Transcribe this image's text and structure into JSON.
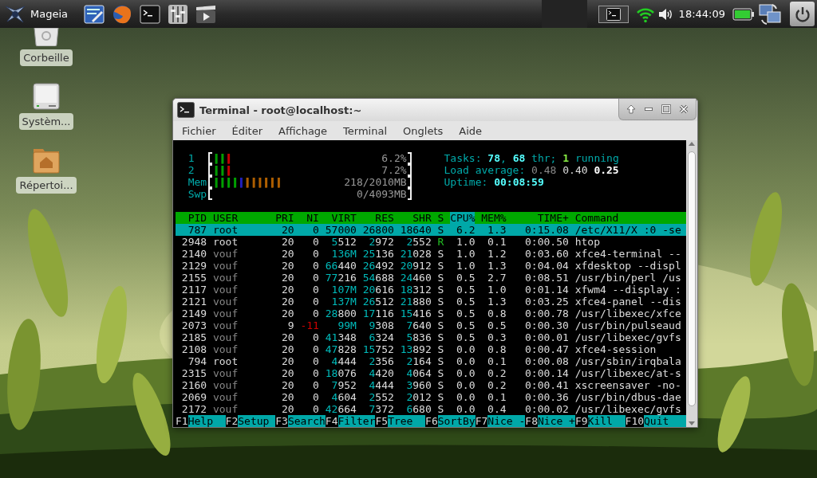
{
  "panel": {
    "app_menu": "Mageia",
    "clock": "18:44:09"
  },
  "desktop_icons": [
    {
      "label": "Corbeille",
      "kind": "trash"
    },
    {
      "label": "Systèm...",
      "kind": "drive"
    },
    {
      "label": "Répertoi...",
      "kind": "home"
    }
  ],
  "window": {
    "title": "Terminal - root@localhost:~",
    "menu": [
      "Fichier",
      "Éditer",
      "Affichage",
      "Terminal",
      "Onglets",
      "Aide"
    ]
  },
  "htop": {
    "meters": [
      {
        "label": "1",
        "reading": "6.2%",
        "bars": [
          {
            "text": "||",
            "color": "#00a000"
          },
          {
            "text": "|",
            "color": "#c00000"
          }
        ]
      },
      {
        "label": "2",
        "reading": "7.2%",
        "bars": [
          {
            "text": "||",
            "color": "#00a000"
          },
          {
            "text": "|",
            "color": "#c00000"
          }
        ]
      },
      {
        "label": "Mem",
        "reading": "218/2010MB",
        "bars": [
          {
            "text": "||||",
            "color": "#00a000"
          },
          {
            "text": "|",
            "color": "#2020c0"
          },
          {
            "text": "||||||",
            "color": "#b06000"
          }
        ]
      },
      {
        "label": "Swp",
        "reading": "0/4093MB"
      }
    ],
    "status_lines": [
      {
        "parts": [
          {
            "text": "Tasks: ",
            "kind": "label"
          },
          {
            "text": "78",
            "kind": "value"
          },
          {
            "text": ", ",
            "kind": "label"
          },
          {
            "text": "68",
            "kind": "value"
          },
          {
            "text": " thr; ",
            "kind": "label"
          },
          {
            "text": "1",
            "kind": "running"
          },
          {
            "text": " running",
            "kind": "label"
          }
        ]
      },
      {
        "parts": [
          {
            "text": "Load average: ",
            "kind": "label"
          },
          {
            "text": "0.48",
            "kind": "dim"
          },
          {
            "text": " 0.40",
            "kind": "normal"
          },
          {
            "text": " 0.25",
            "kind": "bold"
          }
        ]
      },
      {
        "parts": [
          {
            "text": "Uptime: ",
            "kind": "label"
          },
          {
            "text": "00:08:59",
            "kind": "value"
          }
        ]
      }
    ],
    "columns": [
      {
        "label": "PID",
        "sorted": false
      },
      {
        "label": "USER",
        "sorted": false
      },
      {
        "label": "PRI",
        "sorted": false
      },
      {
        "label": "NI",
        "sorted": false
      },
      {
        "label": "VIRT",
        "sorted": false
      },
      {
        "label": "RES",
        "sorted": false
      },
      {
        "label": "SHR",
        "sorted": false
      },
      {
        "label": "S",
        "sorted": false
      },
      {
        "label": "CPU%",
        "sorted": true
      },
      {
        "label": "MEM%",
        "sorted": false
      },
      {
        "label": "TIME+",
        "sorted": false
      },
      {
        "label": "Command",
        "sorted": false
      }
    ],
    "rows": [
      {
        "cells": [
          "787",
          "root",
          "20",
          "0",
          "57000",
          "26800",
          "18640",
          "S",
          "6.2",
          "1.3",
          "0:15.08",
          "/etc/X11/X :0 -se"
        ],
        "selected": true
      },
      {
        "cells": [
          "2948",
          "root",
          "20",
          "0",
          "5512",
          "2972",
          "2552",
          "R",
          "1.0",
          "0.1",
          "0:00.50",
          "htop"
        ],
        "selected": false,
        "dimmed_user": false,
        "running": true
      },
      {
        "cells": [
          "2140",
          "vouf",
          "20",
          "0",
          "136M",
          "25136",
          "21028",
          "S",
          "1.0",
          "1.2",
          "0:03.60",
          "xfce4-terminal --"
        ],
        "selected": false,
        "dimmed_user": true,
        "running": false
      },
      {
        "cells": [
          "2129",
          "vouf",
          "20",
          "0",
          "66440",
          "26492",
          "20912",
          "S",
          "1.0",
          "1.3",
          "0:04.04",
          "xfdesktop --displ"
        ],
        "selected": false,
        "dimmed_user": true,
        "running": false
      },
      {
        "cells": [
          "2155",
          "vouf",
          "20",
          "0",
          "77216",
          "54688",
          "24460",
          "S",
          "0.5",
          "2.7",
          "0:08.51",
          "/usr/bin/perl /us"
        ],
        "selected": false,
        "dimmed_user": true,
        "running": false
      },
      {
        "cells": [
          "2117",
          "vouf",
          "20",
          "0",
          "107M",
          "20616",
          "18312",
          "S",
          "0.5",
          "1.0",
          "0:01.14",
          "xfwm4 --display :"
        ],
        "selected": false,
        "dimmed_user": true,
        "running": false
      },
      {
        "cells": [
          "2121",
          "vouf",
          "20",
          "0",
          "137M",
          "26512",
          "21880",
          "S",
          "0.5",
          "1.3",
          "0:03.25",
          "xfce4-panel --dis"
        ],
        "selected": false,
        "dimmed_user": true,
        "running": false
      },
      {
        "cells": [
          "2149",
          "vouf",
          "20",
          "0",
          "28800",
          "17116",
          "15416",
          "S",
          "0.5",
          "0.8",
          "0:00.78",
          "/usr/libexec/xfce"
        ],
        "selected": false,
        "dimmed_user": true,
        "running": false
      },
      {
        "cells": [
          "2073",
          "vouf",
          "9",
          "-11",
          "99M",
          "9308",
          "7640",
          "S",
          "0.5",
          "0.5",
          "0:00.30",
          "/usr/bin/pulseaud"
        ],
        "selected": false,
        "dimmed_user": true,
        "running": false
      },
      {
        "cells": [
          "2185",
          "vouf",
          "20",
          "0",
          "41348",
          "6324",
          "5836",
          "S",
          "0.5",
          "0.3",
          "0:00.01",
          "/usr/libexec/gvfs"
        ],
        "selected": false,
        "dimmed_user": true,
        "running": false
      },
      {
        "cells": [
          "2108",
          "vouf",
          "20",
          "0",
          "47828",
          "15752",
          "13892",
          "S",
          "0.0",
          "0.8",
          "0:00.47",
          "xfce4-session"
        ],
        "selected": false,
        "dimmed_user": true,
        "running": false
      },
      {
        "cells": [
          "794",
          "root",
          "20",
          "0",
          "4444",
          "2356",
          "2164",
          "S",
          "0.0",
          "0.1",
          "0:00.08",
          "/usr/sbin/irqbala"
        ],
        "selected": false,
        "dimmed_user": false,
        "running": false
      },
      {
        "cells": [
          "2315",
          "vouf",
          "20",
          "0",
          "18076",
          "4420",
          "4064",
          "S",
          "0.0",
          "0.2",
          "0:00.14",
          "/usr/libexec/at-s"
        ],
        "selected": false,
        "dimmed_user": true,
        "running": false
      },
      {
        "cells": [
          "2160",
          "vouf",
          "20",
          "0",
          "7952",
          "4444",
          "3960",
          "S",
          "0.0",
          "0.2",
          "0:00.41",
          "xscreensaver -no-"
        ],
        "selected": false,
        "dimmed_user": true,
        "running": false
      },
      {
        "cells": [
          "2069",
          "vouf",
          "20",
          "0",
          "4604",
          "2552",
          "2012",
          "S",
          "0.0",
          "0.1",
          "0:00.36",
          "/usr/bin/dbus-dae"
        ],
        "selected": false,
        "dimmed_user": true,
        "running": false
      },
      {
        "cells": [
          "2172",
          "vouf",
          "20",
          "0",
          "42664",
          "7372",
          "6680",
          "S",
          "0.0",
          "0.4",
          "0:00.02",
          "/usr/libexec/gvfs"
        ],
        "selected": false,
        "dimmed_user": true,
        "running": false
      }
    ],
    "function_keys": [
      {
        "key": "F1",
        "label": "Help"
      },
      {
        "key": "F2",
        "label": "Setup"
      },
      {
        "key": "F3",
        "label": "Search"
      },
      {
        "key": "F4",
        "label": "Filter"
      },
      {
        "key": "F5",
        "label": "Tree"
      },
      {
        "key": "F6",
        "label": "SortBy"
      },
      {
        "key": "F7",
        "label": "Nice -"
      },
      {
        "key": "F8",
        "label": "Nice +"
      },
      {
        "key": "F9",
        "label": "Kill"
      },
      {
        "key": "F10",
        "label": "Quit"
      }
    ]
  }
}
